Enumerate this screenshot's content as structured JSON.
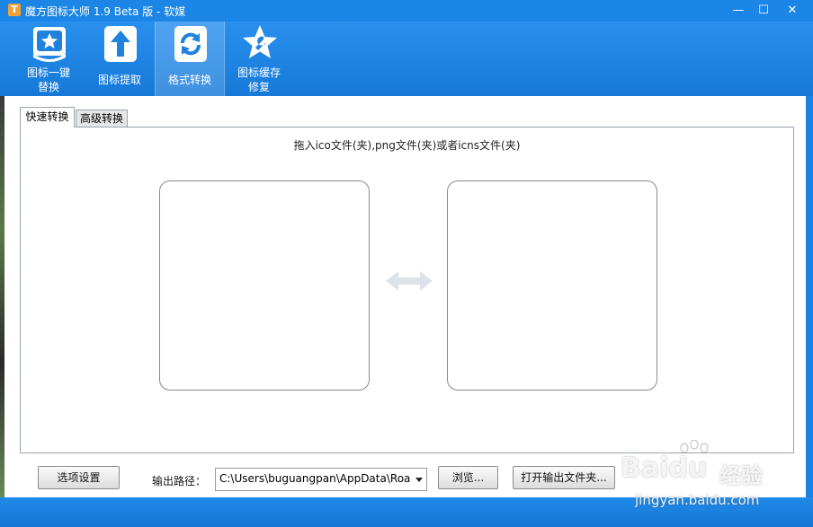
{
  "window": {
    "title": "魔方图标大师 1.9 Beta 版 - 软媒",
    "app_icon_glyph": "T",
    "minimize": "—",
    "maximize": "☐",
    "close": "✕"
  },
  "toolbar": {
    "items": [
      {
        "line1": "图标一键",
        "line2": "替换",
        "icon": "star-card-icon",
        "active": false
      },
      {
        "line1": "图标提取",
        "line2": "",
        "icon": "upload-arrow-icon",
        "active": false
      },
      {
        "line1": "格式转换",
        "line2": "",
        "icon": "refresh-icon",
        "active": true
      },
      {
        "line1": "图标缓存",
        "line2": "修复",
        "icon": "wrench-star-icon",
        "active": false
      }
    ]
  },
  "tabs": [
    {
      "label": "快速转换",
      "active": true
    },
    {
      "label": "高级转换",
      "active": false
    }
  ],
  "quick_convert": {
    "hint": "拖入ico文件(夹),png文件(夹)或者icns文件(夹)",
    "swap_icon": "double-arrow-icon"
  },
  "bottom": {
    "options_button": "选项设置",
    "output_path_label": "输出路径：",
    "output_path_value": "C:\\Users\\buguangpan\\AppData\\Roa",
    "browse_button": "浏览...",
    "open_folder_button": "打开输出文件夹..."
  },
  "watermark": {
    "logo": "Bai",
    "logo_suffix": "du",
    "chinese": "经验",
    "url": "jingyan.baidu.com"
  },
  "colors": {
    "accent": "#1b86e6",
    "panel_border": "#9aa3ad"
  }
}
